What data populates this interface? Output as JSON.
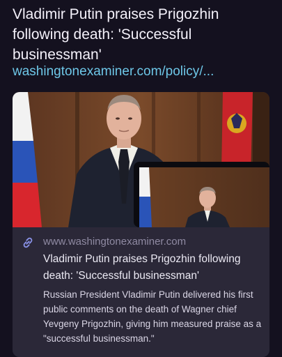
{
  "post": {
    "title": "Vladimir Putin praises Prigozhin following death: 'Successful businessman'",
    "link_text": "washingtonexaminer.com/policy/..."
  },
  "card": {
    "domain": "www.washingtonexaminer.com",
    "headline": "Vladimir Putin praises Prigozhin following death: 'Successful businessman'",
    "description": "Russian President Vladimir Putin delivered his first public comments on the death of Wagner chief Yevgeny Prigozhin, giving him measured praise as a \"successful businessman.\"",
    "image_icon": "putin-photo",
    "link_icon": "link-icon"
  },
  "colors": {
    "background": "#14111f",
    "link": "#6ec7e8",
    "card": "#2b2838",
    "domain": "#8f8aa2"
  }
}
